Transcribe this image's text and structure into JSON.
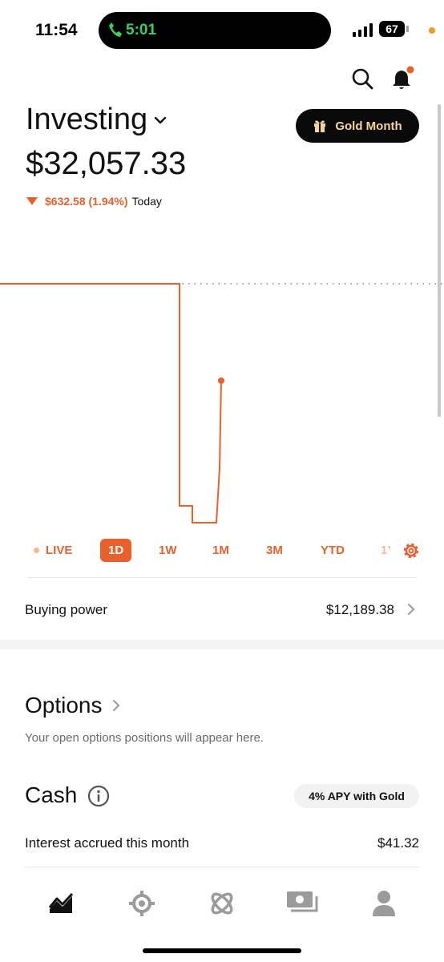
{
  "status_bar": {
    "time": "11:54",
    "call_timer": "5:01",
    "battery": "67"
  },
  "header": {
    "account_title": "Investing",
    "gold_button_label": "Gold Month",
    "balance": "$32,057.33",
    "change_amount": "$632.58 (1.94%)",
    "change_period": "Today"
  },
  "colors": {
    "accent": "#e8612c",
    "gold_text": "#f5d59a"
  },
  "chart_data": {
    "type": "line",
    "series": [
      {
        "values": [
          32689.91,
          32689.91,
          32689.91,
          31240.0,
          31240.0,
          31130.0,
          31130.0,
          31130.0,
          32057.33
        ]
      }
    ],
    "reference_line": 32689.91,
    "grid": false,
    "xlabel": "",
    "ylabel": ""
  },
  "ranges": {
    "items": [
      "LIVE",
      "1D",
      "1W",
      "1M",
      "3M",
      "YTD",
      "1Y"
    ],
    "active": "1D"
  },
  "buying_power": {
    "label": "Buying power",
    "value": "$12,189.38"
  },
  "options": {
    "title": "Options",
    "subtitle": "Your open options positions will appear here."
  },
  "cash": {
    "title": "Cash",
    "apy_badge": "4% APY with Gold",
    "interest_label": "Interest accrued this month",
    "interest_value": "$41.32"
  },
  "tabbar": {
    "icons": [
      "chart-icon",
      "crypto-icon",
      "network-icon",
      "cash-icon",
      "account-icon"
    ]
  }
}
